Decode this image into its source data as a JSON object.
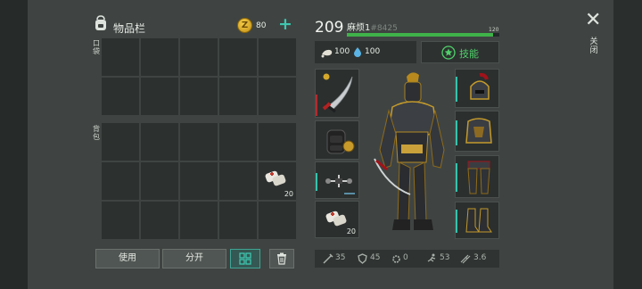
{
  "inventory": {
    "title": "物品栏",
    "coins": "80",
    "plus": "+",
    "pocket_label": "口袋",
    "backpack_label": "背包",
    "bandage_count": "20"
  },
  "buttons": {
    "use": "使用",
    "split": "分开"
  },
  "player": {
    "level": "209",
    "name": "麻烦1",
    "id": "#8425",
    "xp_max": "120",
    "xp_fraction": 0.96,
    "food": "100",
    "water": "100",
    "skills": "技能"
  },
  "equipment": {
    "bandage_count": "20"
  },
  "stats": [
    "35",
    "45",
    "0",
    "53",
    "3.6"
  ],
  "close_label": "关闭",
  "colors": {
    "accent": "#3ec7b0",
    "xp": "#3fb24a",
    "skill": "#4fd06a"
  }
}
